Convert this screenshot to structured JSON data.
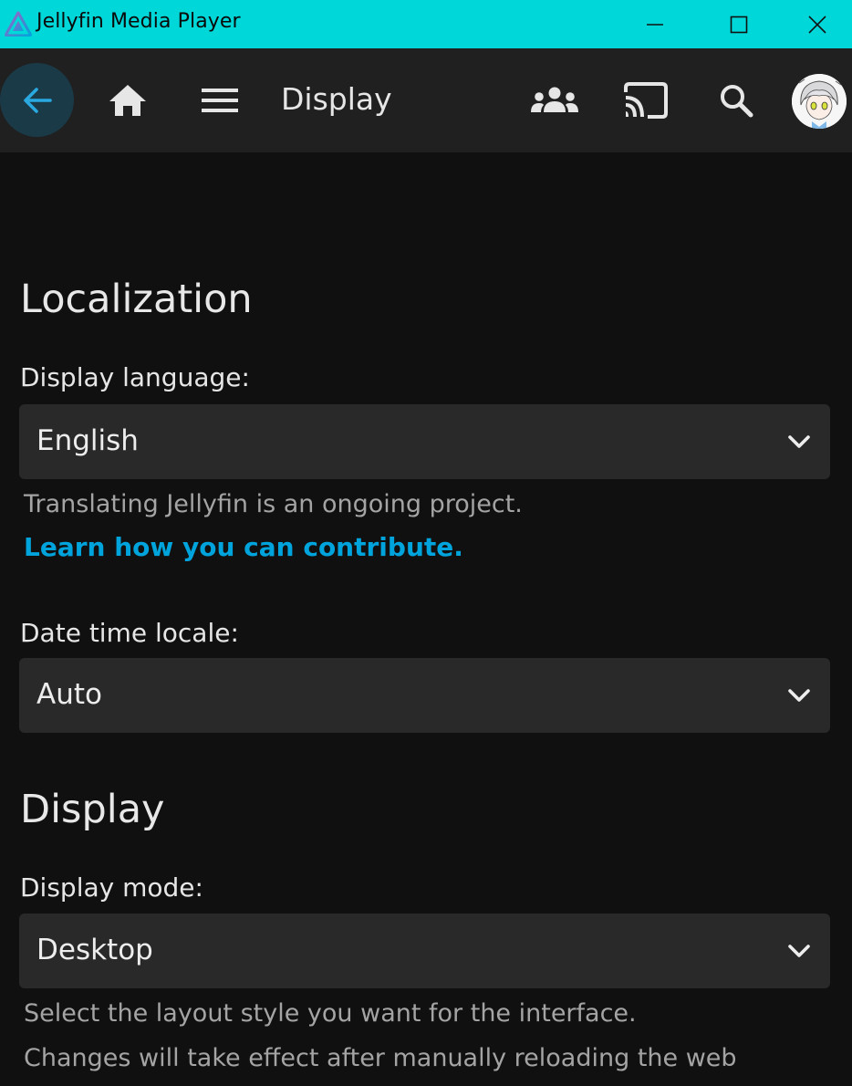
{
  "window": {
    "title": "Jellyfin Media Player",
    "accent_color": "#00d7d9"
  },
  "header": {
    "page_title": "Display",
    "icons": {
      "back": "arrow-left-icon",
      "home": "home-icon",
      "menu": "hamburger-menu-icon",
      "syncplay": "group-icon",
      "cast": "cast-icon",
      "search": "search-icon",
      "avatar": "user-avatar"
    }
  },
  "localization": {
    "section_title": "Localization",
    "display_language": {
      "label": "Display language:",
      "value": "English",
      "help": "Translating Jellyfin is an ongoing project.",
      "link": "Learn how you can contribute."
    },
    "date_time_locale": {
      "label": "Date time locale:",
      "value": "Auto"
    }
  },
  "display": {
    "section_title": "Display",
    "display_mode": {
      "label": "Display mode:",
      "value": "Desktop",
      "help_1": "Select the layout style you want for the interface.",
      "help_2": "Changes will take effect after manually reloading the web"
    }
  },
  "colors": {
    "link": "#00a4dc",
    "back_button_bg": "#1b3a48",
    "header_bg": "#202020",
    "select_bg": "#292929"
  }
}
